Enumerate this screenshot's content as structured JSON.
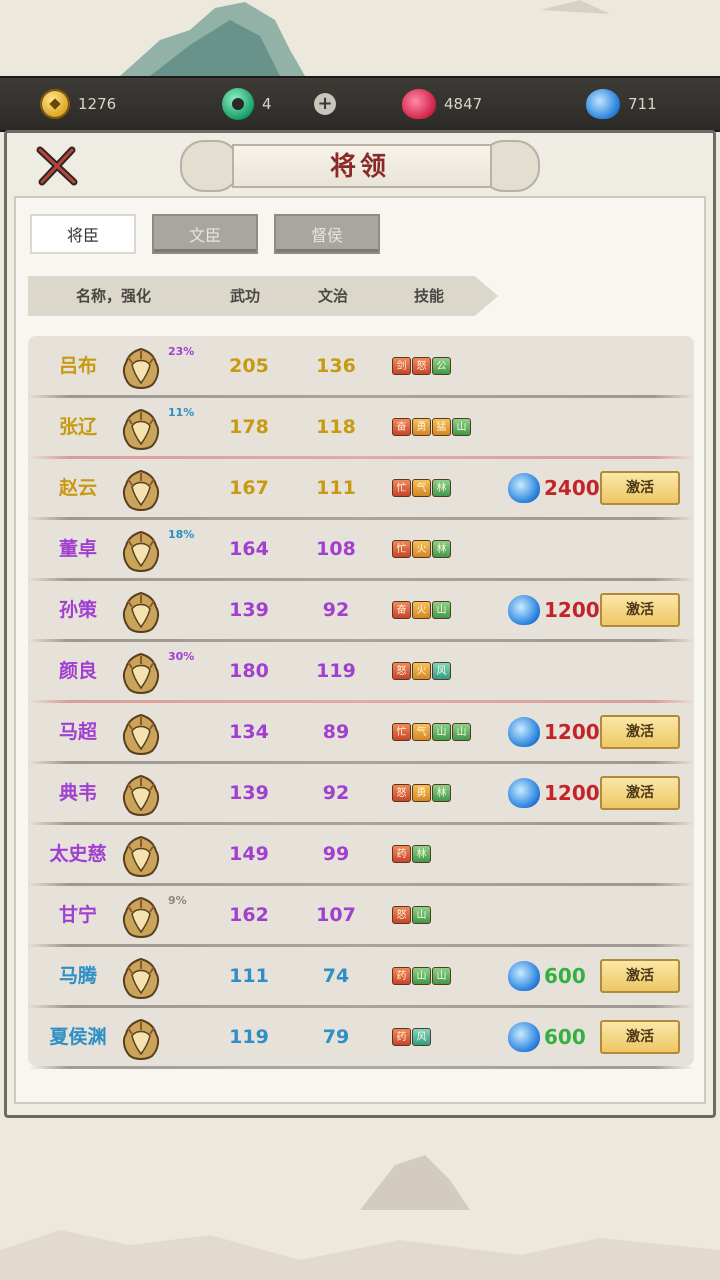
{
  "resources": {
    "gold": {
      "icon": "gold-coin-icon",
      "value": "1276"
    },
    "jade": {
      "icon": "jade-disc-icon",
      "value": "4"
    },
    "add": {
      "icon": "plus-icon"
    },
    "peach": {
      "icon": "peach-icon",
      "value": "4847"
    },
    "crystal": {
      "icon": "blue-crystal-icon",
      "value": "711"
    }
  },
  "title": "将领",
  "tabs": [
    {
      "label": "将臣",
      "active": true
    },
    {
      "label": "文臣",
      "active": false
    },
    {
      "label": "督侯",
      "active": false
    }
  ],
  "columns": {
    "name": "名称，强化",
    "wu": "武功",
    "wen": "文治",
    "skill": "技能"
  },
  "activate_label": "激活",
  "rows": [
    {
      "name": "吕布",
      "pct": "23%",
      "wu": "205",
      "wen": "136",
      "skills": [
        "剑",
        "怒",
        "公"
      ],
      "cost": null,
      "tier": "gold"
    },
    {
      "name": "张辽",
      "pct": "11%",
      "wu": "178",
      "wen": "118",
      "skills": [
        "奋",
        "勇",
        "猛",
        "山"
      ],
      "cost": null,
      "tier": "gold"
    },
    {
      "name": "赵云",
      "pct": "",
      "wu": "167",
      "wen": "111",
      "skills": [
        "忙",
        "气",
        "林"
      ],
      "cost": "2400",
      "tier": "gold"
    },
    {
      "name": "董卓",
      "pct": "18%",
      "wu": "164",
      "wen": "108",
      "skills": [
        "忙",
        "火",
        "林"
      ],
      "cost": null,
      "tier": "purple"
    },
    {
      "name": "孙策",
      "pct": "",
      "wu": "139",
      "wen": "92",
      "skills": [
        "奋",
        "火",
        "山"
      ],
      "cost": "1200",
      "tier": "purple"
    },
    {
      "name": "颜良",
      "pct": "30%",
      "wu": "180",
      "wen": "119",
      "skills": [
        "怒",
        "火",
        "风"
      ],
      "cost": null,
      "tier": "purple"
    },
    {
      "name": "马超",
      "pct": "",
      "wu": "134",
      "wen": "89",
      "skills": [
        "忙",
        "气",
        "山",
        "山"
      ],
      "cost": "1200",
      "tier": "purple"
    },
    {
      "name": "典韦",
      "pct": "",
      "wu": "139",
      "wen": "92",
      "skills": [
        "怒",
        "勇",
        "林"
      ],
      "cost": "1200",
      "tier": "purple"
    },
    {
      "name": "太史慈",
      "pct": "",
      "wu": "149",
      "wen": "99",
      "skills": [
        "药",
        "林"
      ],
      "cost": null,
      "tier": "purple"
    },
    {
      "name": "甘宁",
      "pct": "9%",
      "wu": "162",
      "wen": "107",
      "skills": [
        "怒",
        "山"
      ],
      "cost": null,
      "tier": "purple"
    },
    {
      "name": "马腾",
      "pct": "",
      "wu": "111",
      "wen": "74",
      "skills": [
        "药",
        "山",
        "山"
      ],
      "cost": "600",
      "tier": "blue"
    },
    {
      "name": "夏侯渊",
      "pct": "",
      "wu": "119",
      "wen": "79",
      "skills": [
        "药",
        "风"
      ],
      "cost": "600",
      "tier": "blue"
    }
  ]
}
